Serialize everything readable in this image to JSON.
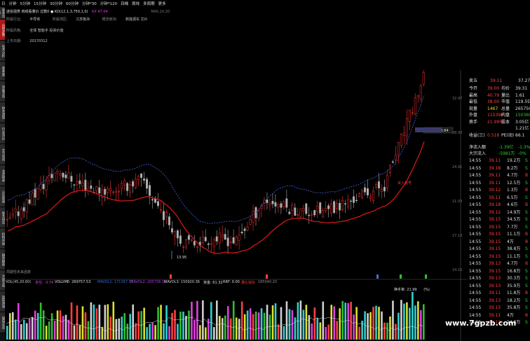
{
  "toolbar": {
    "items": [
      "日",
      "分钟",
      "5分钟",
      "15分钟",
      "30分钟",
      "60分钟",
      "分钟*30",
      "分钟*120",
      "日线",
      "周线",
      "多周期",
      "更多"
    ]
  },
  "left_tabs": [
    "基本资料",
    "分时走势",
    "技术分析",
    "基本面",
    "资金流向",
    "财务透视",
    "行业对比",
    "主力动向",
    "龙虎榜单",
    "公告新闻",
    "股东研究",
    "机构评级",
    "融资融券",
    "大宗交易",
    "盈利预测",
    "操盘必读"
  ],
  "info": {
    "title_line": "迷信强势 四线看量价 过数0  ● KD(12,1,3,750,1,0)",
    "kd_values": "KX 47.04",
    "right_label": "MA5,10,20",
    "row2": [
      "所属行业: ",
      "半导体",
      "所属地区:",
      "江苏板块",
      "概念板块:",
      "新能源车 芯片"
    ],
    "row3": [
      "所属风格:",
      "全球 智能手 投资价值"
    ],
    "row4": [
      "上市日期:",
      "20170312"
    ]
  },
  "chart_labels": {
    "low_label": "13.95",
    "high_tag": "28.64 - 28.84",
    "buy_tag": "买入信号",
    "hint_text": "双均线 均线系统",
    "bottom_hint": "周期性未来函数"
  },
  "price_axis": [
    "32.97",
    "28.93",
    "24.91",
    "21.03",
    "17.13",
    "14.15"
  ],
  "volume_legend": {
    "vol_title": "VOL(45,20,60)",
    "vol_value": "多空: -3.74",
    "volume": "VOLUME: 269757.53",
    "mavol1": "MAVOL1: 171367.57",
    "mavol2": "MAVOL2: 205738.31",
    "mavol3": "MAVOL3: 150920.36",
    "extra": "资金: 61.32",
    "rrf": "RRF: 0.00",
    "flag": "量比指标",
    "tail": "185940.20",
    "turnover": "换手率: 21.99",
    "turnover_pct": "(%)"
  },
  "quote": {
    "sell5": {
      "label": "卖五",
      "price": "39.11",
      "vol": "37.27"
    },
    "rows": [
      {
        "l": "今开",
        "v": "39.00",
        "l2": "均价",
        "v2": "39.31"
      },
      {
        "l": "最高",
        "v": "40.79",
        "l2": "量比",
        "v2": "1.61"
      },
      {
        "l": "最低",
        "v": "38.00",
        "l2": "市值",
        "v2": "119.5亿"
      },
      {
        "l": "现量",
        "v": "1467",
        "l2": "总量",
        "v2": "265750"
      },
      {
        "l": "外盘",
        "v": "115398",
        "l2": "内盘",
        "v2": "150360"
      },
      {
        "l": "换手",
        "v": "21.99%",
        "l2": "股本",
        "v2": "3.05亿"
      },
      {
        "l": "",
        "v": "",
        "l2": "",
        "v2": "1.21亿"
      },
      {
        "l": "收益(三)",
        "v": "0.518",
        "l2": "PE(动)",
        "v2": "66.1"
      }
    ],
    "flow": [
      {
        "label": "净流入额",
        "v1": "-1.39亿",
        "v2": "-1.3%"
      },
      {
        "label": "大宗流入",
        "v1": "-5981万",
        "v2": "-0%"
      }
    ],
    "ticks": [
      {
        "t": "14:55",
        "p": "39.11",
        "v": "19.2万",
        "d": "S"
      },
      {
        "t": "14:55",
        "p": "39.18",
        "v": "8.2万",
        "d": "S"
      },
      {
        "t": "14:55",
        "p": "39.11",
        "v": "4.7万",
        "d": "B"
      },
      {
        "t": "14:55",
        "p": "39.11",
        "v": "12.5万",
        "d": "S"
      },
      {
        "t": "14:55",
        "p": "39.12",
        "v": "1.3万",
        "d": "B"
      },
      {
        "t": "14:55",
        "p": "39.11",
        "v": "6.5万",
        "d": "S"
      },
      {
        "t": "14:55",
        "p": "39.18",
        "v": "4.6万",
        "d": "B"
      },
      {
        "t": "14:55",
        "p": "39.12",
        "v": "14.9万",
        "d": "S"
      },
      {
        "t": "14:55",
        "p": "39.15",
        "v": "34.5万",
        "d": "S"
      },
      {
        "t": "14:55",
        "p": "39.15",
        "v": "7.7万",
        "d": "S"
      },
      {
        "t": "14:55",
        "p": "39.15",
        "v": "11.1万",
        "d": "B"
      },
      {
        "t": "14:55",
        "p": "39.15",
        "v": "4万",
        "d": "B"
      },
      {
        "t": "14:55",
        "p": "39.15",
        "v": "38.8万",
        "d": "S"
      },
      {
        "t": "14:55",
        "p": "39.15",
        "v": "11.1万",
        "d": "S"
      },
      {
        "t": "14:55",
        "p": "39.13",
        "v": "4.7万",
        "d": "B"
      },
      {
        "t": "14:55",
        "p": "39.15",
        "v": "16.8万",
        "d": "S"
      },
      {
        "t": "14:55",
        "p": "39.13",
        "v": "30.3万",
        "d": "S"
      },
      {
        "t": "14:55",
        "p": "39.13",
        "v": "35.9万",
        "d": "S"
      },
      {
        "t": "14:55",
        "p": "39.11",
        "v": "11.8万",
        "d": "B"
      },
      {
        "t": "14:55",
        "p": "39.13",
        "v": "18.2万",
        "d": "S"
      },
      {
        "t": "14:55",
        "p": "39.15",
        "v": "35.8万",
        "d": "S"
      },
      {
        "t": "14:55",
        "p": "39.11",
        "v": "4万",
        "d": "B"
      },
      {
        "t": "14:55",
        "p": "39.13",
        "v": "14.8万",
        "d": "S"
      }
    ]
  },
  "watermark": "www.7gpzb.com",
  "colors": {
    "up": "#ff3030",
    "down": "#20c8c8",
    "ma_red": "#d01818",
    "ma_blue": "#3a5ac8"
  }
}
